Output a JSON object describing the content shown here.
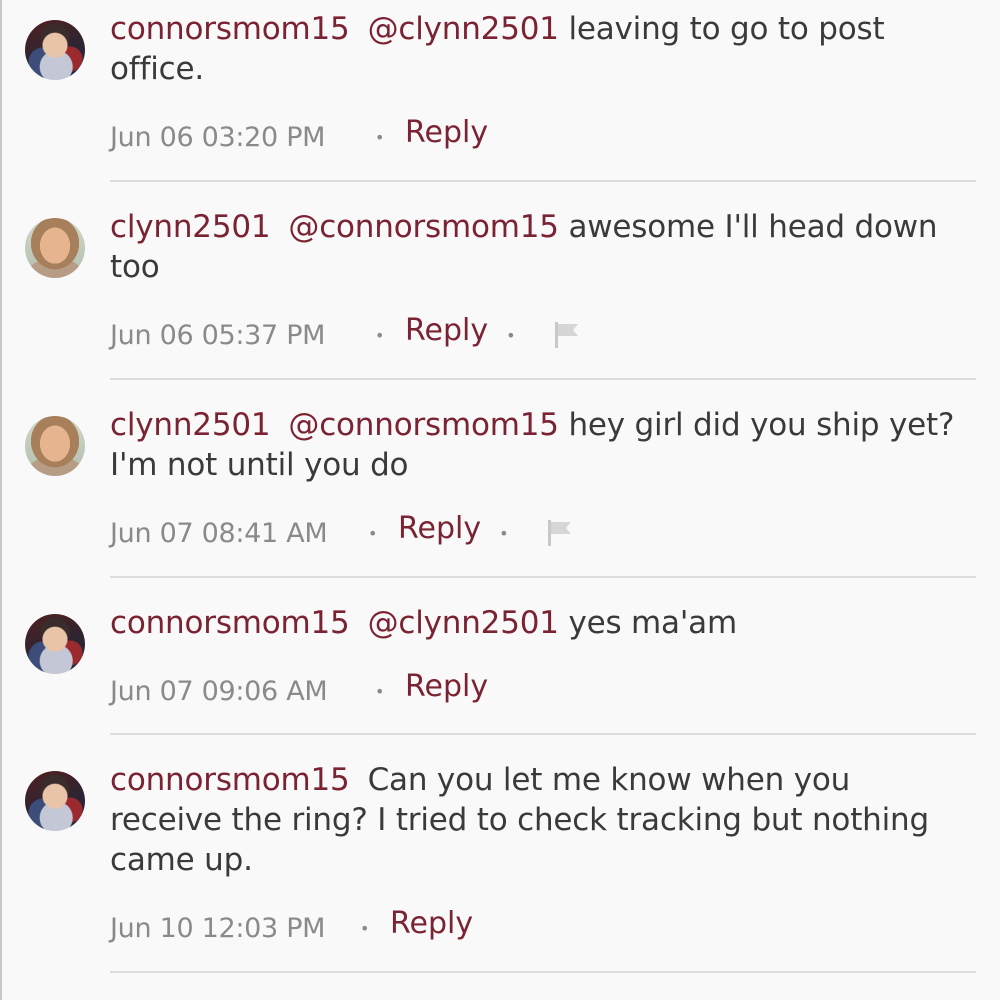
{
  "comments": [
    {
      "username": "connorsmom15",
      "mention": "@clynn2501",
      "text": "leaving to go to post office.",
      "timestamp": "Jun 06 03:20 PM",
      "reply_label": "Reply",
      "avatar": "kid-avatar",
      "flag": false
    },
    {
      "username": "clynn2501",
      "mention": "@connorsmom15",
      "text": "awesome I'll head down too",
      "timestamp": "Jun 06 05:37 PM",
      "reply_label": "Reply",
      "avatar": "woman-avatar",
      "flag": true
    },
    {
      "username": "clynn2501",
      "mention": "@connorsmom15",
      "text": "hey girl did you ship yet? I'm not until you do",
      "timestamp": "Jun 07 08:41 AM",
      "reply_label": "Reply",
      "avatar": "woman-avatar",
      "flag": true
    },
    {
      "username": "connorsmom15",
      "mention": "@clynn2501",
      "text": "yes ma'am",
      "timestamp": "Jun 07 09:06 AM",
      "reply_label": "Reply",
      "avatar": "kid-avatar",
      "flag": false
    },
    {
      "username": "connorsmom15",
      "mention": "",
      "text": "Can you let me know when you receive the ring? I tried to check tracking but nothing came up.",
      "timestamp": "Jun 10 12:03 PM",
      "reply_label": "Reply",
      "avatar": "kid-avatar",
      "flag": false
    }
  ],
  "colors": {
    "accent": "#7a2332",
    "text": "#3a3a3a",
    "muted": "#8a8a8a",
    "divider": "#dcdcdc",
    "background": "#faf9fa"
  },
  "icons": {
    "bullet": "•",
    "flag": "flag-icon"
  }
}
